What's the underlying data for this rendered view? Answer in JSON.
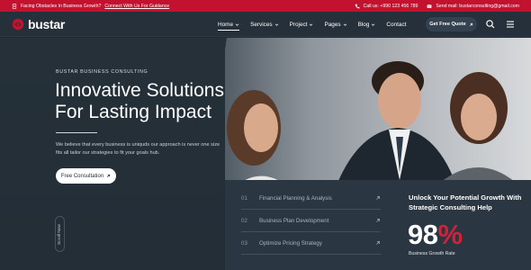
{
  "topbar": {
    "notice": "Facing Obstacles In Business Growth?",
    "notice_link": "Connect With Us For Guidance",
    "phone": "Call us: +990 123 456 789",
    "email": "Send mail: bustarconsulting@gmail.com"
  },
  "brand": {
    "name": "bustar"
  },
  "nav": {
    "items": [
      {
        "label": "Home",
        "dropdown": true,
        "active": true
      },
      {
        "label": "Services",
        "dropdown": true
      },
      {
        "label": "Project",
        "dropdown": true
      },
      {
        "label": "Pages",
        "dropdown": true
      },
      {
        "label": "Blog",
        "dropdown": true
      },
      {
        "label": "Contact",
        "dropdown": false
      }
    ],
    "cta": "Get Free Quote"
  },
  "hero": {
    "eyebrow": "BUSTAR BUSINESS CONSULTING",
    "title_line1": "Innovative Solutions",
    "title_line2": "For Lasting Impact",
    "description": "We believe that every business is uniquds our approach is never one size fits all tailor our strategies to fit your goals hub.",
    "cta": "Free Consultation",
    "scroll_label": "Scroll Now"
  },
  "services": [
    {
      "num": "01",
      "name": "Financial Planning & Analysis"
    },
    {
      "num": "02",
      "name": "Business Plan Development"
    },
    {
      "num": "03",
      "name": "Optimize Pricing Strategy"
    }
  ],
  "growth": {
    "title": "Unlock Your Potential Growth With Strategic Consulting Help",
    "value": "98",
    "unit": "%",
    "label": "Business Growth Rate"
  },
  "colors": {
    "accent": "#c2122f",
    "dark": "#1f2a33",
    "panel": "#2a3641"
  }
}
